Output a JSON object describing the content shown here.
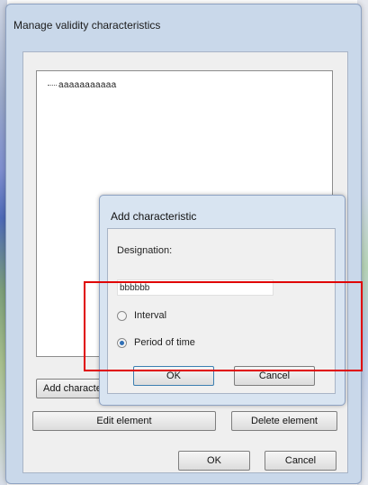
{
  "window": {
    "title": "Manage validity characteristics",
    "tree": {
      "items": [
        "aaaaaaaaaaa"
      ]
    },
    "buttons": {
      "add": "Add characteristic",
      "edit": "Edit element",
      "delete": "Delete element",
      "ok": "OK",
      "cancel": "Cancel"
    }
  },
  "dialog": {
    "title": "Add characteristic",
    "designation_label": "Designation:",
    "designation_value": "bbbbbb",
    "options": [
      {
        "label": "Interval",
        "selected": false
      },
      {
        "label": "Period of time",
        "selected": true
      }
    ],
    "ok": "OK",
    "cancel": "Cancel"
  },
  "colors": {
    "highlight": "#e00000",
    "radio_selected": "#2f6fb5"
  }
}
